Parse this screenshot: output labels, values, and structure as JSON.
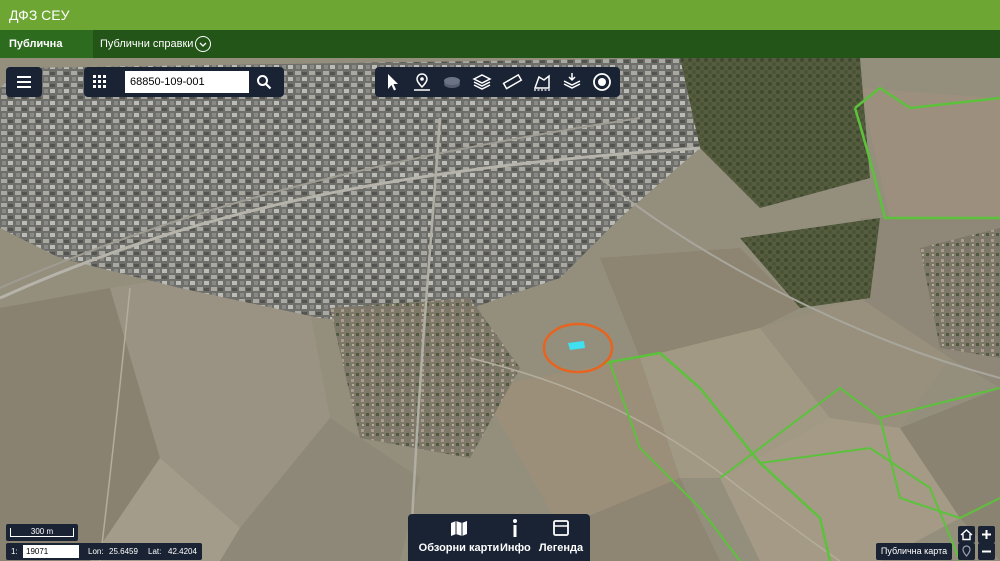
{
  "app": {
    "title": "ДФЗ СЕУ"
  },
  "nav": {
    "tabs": [
      {
        "label": "Публична карта",
        "active": true
      },
      {
        "label": "Публични справки",
        "active": false
      }
    ]
  },
  "search": {
    "value": "68850-109-001"
  },
  "toolbar": {
    "tools": [
      "select-arrow-icon",
      "location-pin-icon",
      "layers-dim-icon",
      "stack-layers-icon",
      "ruler-icon",
      "area-measure-icon",
      "download-layers-icon",
      "target-icon"
    ]
  },
  "bottom_panel": {
    "overview": "Обзорни карти",
    "info": "Инфо",
    "legend": "Легенда"
  },
  "scale": {
    "bar_label": "300 m",
    "ratio_prefix": "1:",
    "ratio_value": "19071"
  },
  "coords": {
    "lon_label": "Lon:",
    "lon_value": "25.6459",
    "lat_label": "Lat:",
    "lat_value": "42.4204"
  },
  "basemap": {
    "label": "Публична карта"
  },
  "colors": {
    "header": "#6ea634",
    "nav": "#225517",
    "panel": "#1a2334",
    "parcel_outline": "#5cc23b",
    "highlight": "#e8641e"
  }
}
